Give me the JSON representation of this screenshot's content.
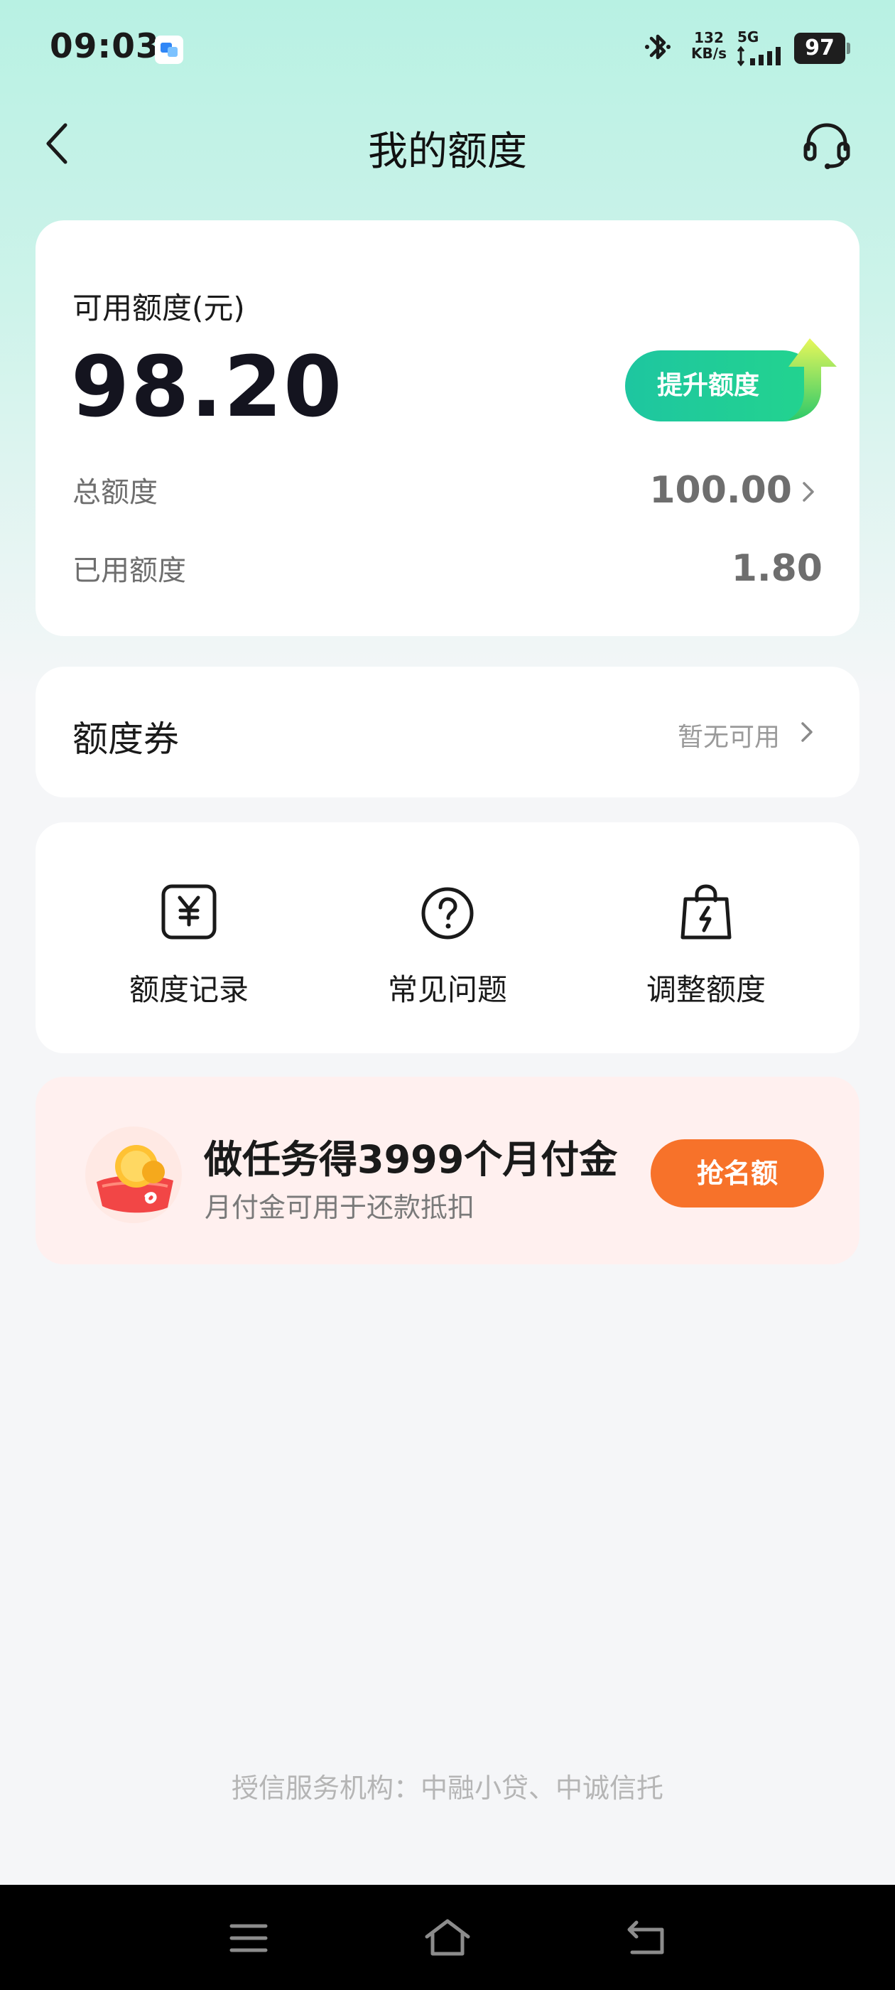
{
  "status_bar": {
    "time": "09:03",
    "net_speed_value": "132",
    "net_speed_unit": "KB/s",
    "network_type": "5G",
    "battery": "97",
    "icons": [
      "app-notification-icon",
      "bluetooth-icon",
      "signal-icon",
      "battery-icon"
    ]
  },
  "header": {
    "title": "我的额度",
    "back_icon": "back-arrow-icon",
    "service_icon": "headset-icon"
  },
  "credit": {
    "available_label": "可用额度(元)",
    "available_amount": "98.20",
    "raise_button": "提升额度",
    "total_label": "总额度",
    "total_value": "100.00",
    "used_label": "已用额度",
    "used_value": "1.80"
  },
  "coupon": {
    "title": "额度券",
    "status": "暂无可用"
  },
  "menu": {
    "items": [
      {
        "label": "额度记录",
        "icon": "yuan-receipt-icon"
      },
      {
        "label": "常见问题",
        "icon": "question-circle-icon"
      },
      {
        "label": "调整额度",
        "icon": "lightning-bag-icon"
      }
    ]
  },
  "promo": {
    "title": "做任务得3999个月付金",
    "subtitle": "月付金可用于还款抵扣",
    "button": "抢名额",
    "icon": "gold-coin-icon"
  },
  "footer": {
    "note": "授信服务机构：中融小贷、中诚信托"
  },
  "colors": {
    "accent_green": "#1ec6a0",
    "promo_orange": "#f7722a",
    "header_gradient_top": "#b8f1e3",
    "promo_background": "#fff0ef"
  }
}
